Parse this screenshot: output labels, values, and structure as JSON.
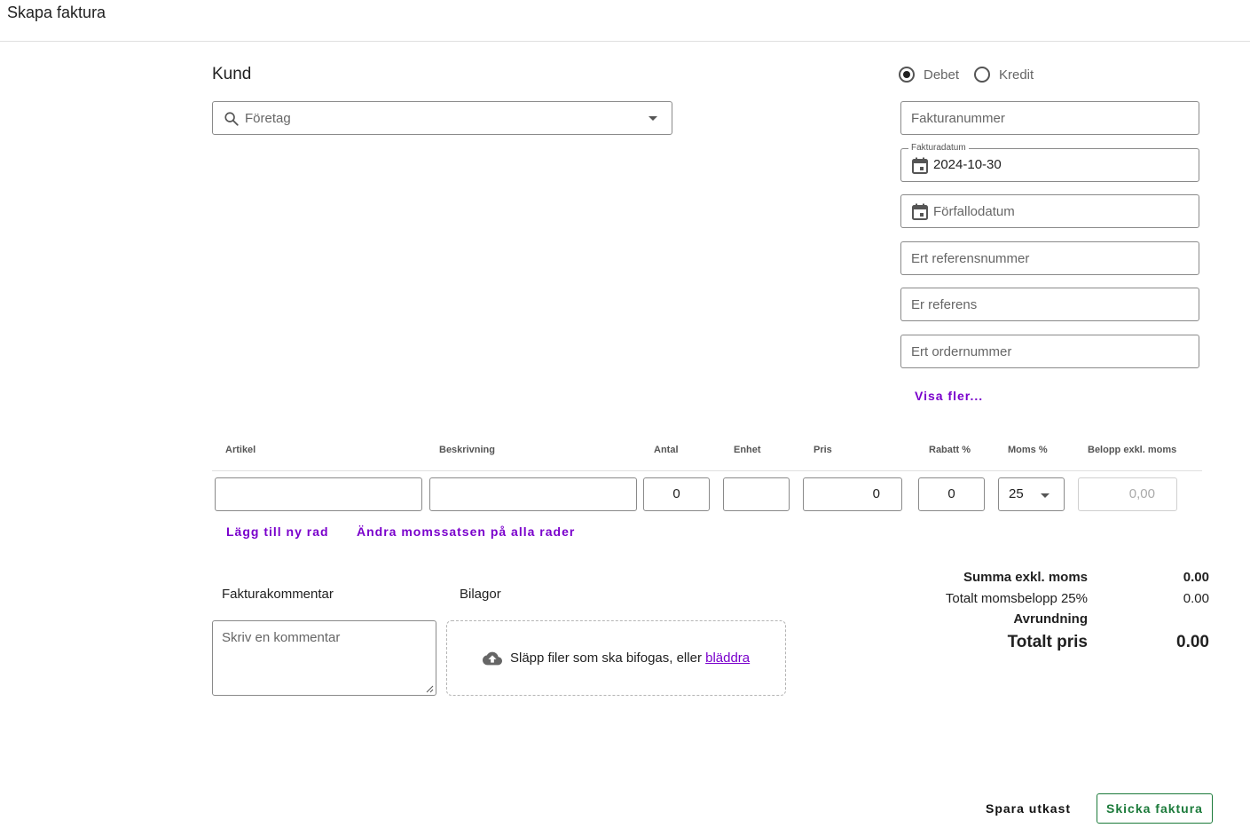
{
  "header": {
    "title": "Skapa faktura"
  },
  "customer": {
    "section_title": "Kund",
    "company_placeholder": "Företag"
  },
  "invoice_type": {
    "options": [
      {
        "label": "Debet",
        "selected": true
      },
      {
        "label": "Kredit",
        "selected": false
      }
    ]
  },
  "invoice_fields": {
    "invoice_number_placeholder": "Fakturanummer",
    "invoice_date_label": "Fakturadatum",
    "invoice_date_value": "2024-10-30",
    "due_date_placeholder": "Förfallodatum",
    "your_reference_number_placeholder": "Ert referensnummer",
    "our_reference_placeholder": "Er referens",
    "your_order_number_placeholder": "Ert ordernummer",
    "show_more_label": "Visa fler..."
  },
  "lines": {
    "columns": [
      "Artikel",
      "Beskrivning",
      "Antal",
      "Enhet",
      "Pris",
      "Rabatt %",
      "Moms %",
      "Belopp exkl. moms"
    ],
    "row": {
      "article": "",
      "description": "",
      "quantity": "0",
      "unit": "",
      "price": "0",
      "discount": "0",
      "vat": "25",
      "amount": "0,00"
    },
    "add_row_label": "Lägg till ny rad",
    "change_vat_label": "Ändra momssatsen på alla rader"
  },
  "comment": {
    "title": "Fakturakommentar",
    "placeholder": "Skriv en kommentar"
  },
  "attachments": {
    "title": "Bilagor",
    "drop_text": "Släpp filer som ska bifogas, eller ",
    "browse_label": "bläddra"
  },
  "summary": {
    "sum_excl_label": "Summa exkl. moms",
    "sum_excl_value": "0.00",
    "vat_total_label": "Totalt momsbelopp 25%",
    "vat_total_value": "0.00",
    "rounding_label": "Avrundning",
    "total_label": "Totalt pris",
    "total_value": "0.00"
  },
  "footer": {
    "save_draft_label": "Spara utkast",
    "send_invoice_label": "Skicka faktura"
  },
  "colors": {
    "accent_purple": "#7a00cc",
    "primary_green": "#1b7a3a"
  }
}
